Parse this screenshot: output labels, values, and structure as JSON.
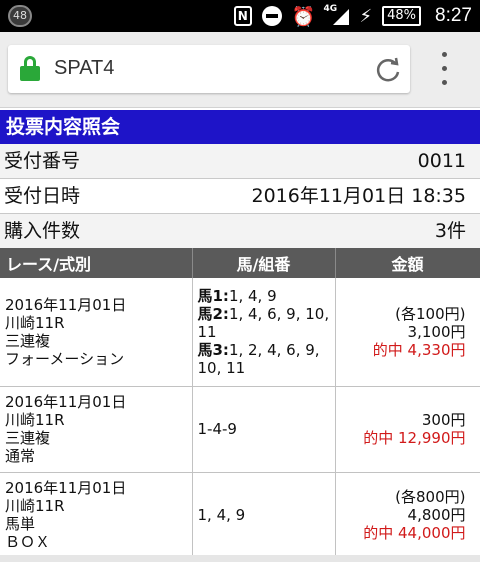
{
  "status_bar": {
    "badge": "48",
    "network_label": "4G",
    "battery": "48%",
    "time": "8:27"
  },
  "browser": {
    "url": "SPAT4"
  },
  "page": {
    "title": "投票内容照会",
    "info": [
      {
        "label": "受付番号",
        "value": "0011"
      },
      {
        "label": "受付日時",
        "value": "2016年11月01日 18:35"
      },
      {
        "label": "購入件数",
        "value": "3件"
      }
    ],
    "table": {
      "headers": [
        "レース/式別",
        "馬/組番",
        "金額"
      ],
      "rows": [
        {
          "race": [
            "2016年11月01日",
            "川崎11R",
            "三連複",
            "フォーメーション"
          ],
          "horses": [
            {
              "label": "馬1:",
              "value": "1, 4, 9"
            },
            {
              "label": "馬2:",
              "value": "1, 4, 6, 9, 10, 11"
            },
            {
              "label": "馬3:",
              "value": "1, 2, 4, 6, 9, 10, 11"
            }
          ],
          "amount_each": "(各100円)",
          "amount_total": "3,100円",
          "hit": "的中 4,330円"
        },
        {
          "race": [
            "2016年11月01日",
            "川崎11R",
            "三連複",
            "通常"
          ],
          "combo": "1-4-9",
          "amount_total": "300円",
          "hit": "的中 12,990円"
        },
        {
          "race": [
            "2016年11月01日",
            "川崎11R",
            "馬単",
            "ＢＯＸ"
          ],
          "combo": "1, 4, 9",
          "amount_each": "(各800円)",
          "amount_total": "4,800円",
          "hit": "的中 44,000円"
        }
      ]
    }
  },
  "colors": {
    "title_bar": "#1e14c8",
    "header_bg": "#5a5a5a",
    "hit_text": "#d11a1a",
    "lock_green": "#2aa839"
  }
}
